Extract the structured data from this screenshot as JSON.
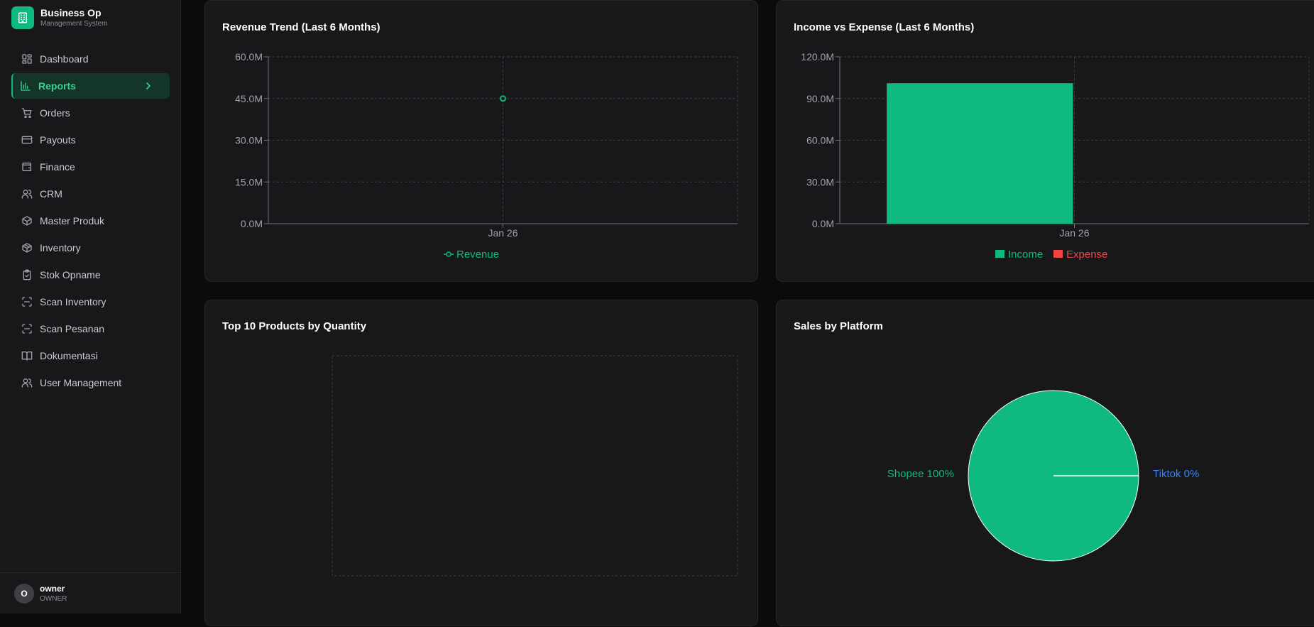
{
  "brand": {
    "title": "Business Op",
    "subtitle": "Management System"
  },
  "nav": {
    "items": [
      {
        "label": "Dashboard",
        "icon": "dashboard-icon"
      },
      {
        "label": "Reports",
        "icon": "bar-chart-icon",
        "active": true
      },
      {
        "label": "Orders",
        "icon": "cart-icon"
      },
      {
        "label": "Payouts",
        "icon": "credit-card-icon"
      },
      {
        "label": "Finance",
        "icon": "wallet-icon"
      },
      {
        "label": "CRM",
        "icon": "users-icon"
      },
      {
        "label": "Master Produk",
        "icon": "box-icon"
      },
      {
        "label": "Inventory",
        "icon": "packages-icon"
      },
      {
        "label": "Stok Opname",
        "icon": "clipboard-check-icon"
      },
      {
        "label": "Scan Inventory",
        "icon": "scan-icon"
      },
      {
        "label": "Scan Pesanan",
        "icon": "scan-icon"
      },
      {
        "label": "Dokumentasi",
        "icon": "book-icon"
      },
      {
        "label": "User Management",
        "icon": "users-icon"
      }
    ]
  },
  "user": {
    "initial": "O",
    "name": "owner",
    "role": "OWNER"
  },
  "colors": {
    "accent": "#10b981",
    "expense": "#ef4444",
    "tiktok": "#3b82f6",
    "card": "#18181b"
  },
  "cards": {
    "revenue": {
      "title": "Revenue Trend (Last 6 Months)"
    },
    "income_expense": {
      "title": "Income vs Expense (Last 6 Months)"
    },
    "top_products": {
      "title": "Top 10 Products by Quantity"
    },
    "platform": {
      "title": "Sales by Platform"
    }
  },
  "chart_data": [
    {
      "type": "line",
      "title": "Revenue Trend (Last 6 Months)",
      "categories": [
        "Jan 26"
      ],
      "series": [
        {
          "name": "Revenue",
          "values": [
            45000000
          ]
        }
      ],
      "ylim": [
        0,
        60000000
      ],
      "yticks": [
        "0.0M",
        "15.0M",
        "30.0M",
        "45.0M",
        "60.0M"
      ],
      "grid": true,
      "legend": "bottom"
    },
    {
      "type": "bar",
      "title": "Income vs Expense (Last 6 Months)",
      "categories": [
        "Jan 26"
      ],
      "series": [
        {
          "name": "Income",
          "values": [
            101000000
          ]
        },
        {
          "name": "Expense",
          "values": [
            0
          ]
        }
      ],
      "ylim": [
        0,
        120000000
      ],
      "yticks": [
        "0.0M",
        "30.0M",
        "60.0M",
        "90.0M",
        "120.0M"
      ],
      "grid": true,
      "legend": "bottom"
    },
    {
      "type": "bar",
      "title": "Top 10 Products by Quantity",
      "categories": [],
      "values": [],
      "grid": true
    },
    {
      "type": "pie",
      "title": "Sales by Platform",
      "labels": [
        "Shopee",
        "Tiktok"
      ],
      "values": [
        100,
        0
      ],
      "label_text": [
        "Shopee 100%",
        "Tiktok 0%"
      ]
    }
  ]
}
